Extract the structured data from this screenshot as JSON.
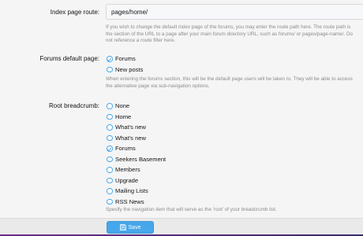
{
  "index_route": {
    "label": "Index page route:",
    "value": "pages/home/",
    "explain": "If you wish to change the default index page of the forums, you may enter the route path here. The route path is the section of the URL to a page after your main forum directory URL, such as forums/ or pages/page-name/. Do not reference a route filter here."
  },
  "forums_default_page": {
    "label": "Forums default page:",
    "options": [
      {
        "label": "Forums",
        "checked": true
      },
      {
        "label": "New posts",
        "checked": false
      }
    ],
    "explain": "When entering the forums section, this will be the default page users will be taken to. They will be able to access the alternative page via sub-navigation options."
  },
  "root_breadcrumb": {
    "label": "Root breadcrumb:",
    "options": [
      {
        "label": "None",
        "checked": false
      },
      {
        "label": "Home",
        "checked": false
      },
      {
        "label": "What's new",
        "checked": false
      },
      {
        "label": "What's new",
        "checked": false
      },
      {
        "label": "Forums",
        "checked": true
      },
      {
        "label": "Seekers Basement",
        "checked": false
      },
      {
        "label": "Members",
        "checked": false
      },
      {
        "label": "Upgrade",
        "checked": false
      },
      {
        "label": "Mailing Lists",
        "checked": false
      },
      {
        "label": "RSS News",
        "checked": false
      }
    ],
    "explain": "Specify the navigation item that will serve as the 'root' of your breadcrumb list."
  },
  "footer": {
    "save_label": "Save",
    "save_icon": "save-icon"
  },
  "colors": {
    "accent": "#47a7eb",
    "explain_text": "#8c8c8c",
    "footer_bg": "#eaeaea"
  }
}
